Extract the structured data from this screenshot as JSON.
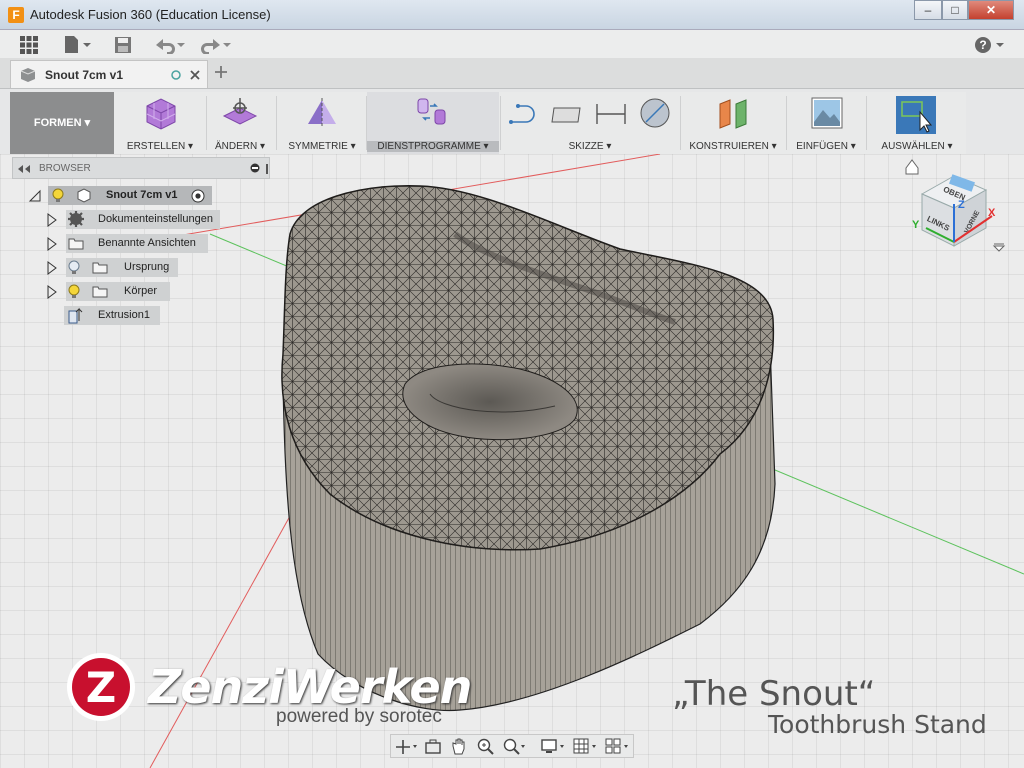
{
  "window": {
    "title": "Autodesk Fusion 360 (Education License)",
    "app_icon_letter": "F"
  },
  "document_tab": {
    "label": "Snout 7cm v1"
  },
  "toolbar": {
    "workspace": "FORMEN",
    "groups": [
      {
        "label": "ERSTELLEN",
        "icon": "create-box-icon"
      },
      {
        "label": "ÄNDERN",
        "icon": "modify-icon"
      },
      {
        "label": "SYMMETRIE",
        "icon": "symmetry-icon"
      },
      {
        "label": "DIENSTPROGRAMME",
        "icon": "utilities-icon"
      },
      {
        "label": "SKIZZE",
        "icon": "sketch-icon"
      },
      {
        "label": "KONSTRUIEREN",
        "icon": "construct-icon"
      },
      {
        "label": "EINFÜGEN",
        "icon": "insert-image-icon"
      },
      {
        "label": "AUSWÄHLEN",
        "icon": "select-icon"
      }
    ],
    "dropdown_glyph": "▾"
  },
  "browser": {
    "title": "BROWSER",
    "root": "Snout 7cm v1",
    "items": [
      {
        "label": "Dokumenteinstellungen",
        "icon": "gear-icon"
      },
      {
        "label": "Benannte Ansichten",
        "icon": "folder-icon"
      },
      {
        "label": "Ursprung",
        "icon": "folder-icon"
      },
      {
        "label": "Körper",
        "icon": "folder-icon"
      },
      {
        "label": "Extrusion1",
        "icon": "extrusion-icon"
      }
    ]
  },
  "viewcube": {
    "top": "OBEN",
    "left": "LINKS",
    "front": "VORNE",
    "x": "X",
    "y": "Y",
    "z": "Z"
  },
  "overlay": {
    "brand_letter": "Z",
    "brand_name": "ZenziWerken",
    "brand_sub": "powered by sorotec",
    "project_title": "„The Snout“",
    "project_sub": "Toothbrush Stand"
  },
  "colors": {
    "accent": "#f29014",
    "select_blue": "#3a78b8",
    "mesh": "#9b968e"
  }
}
